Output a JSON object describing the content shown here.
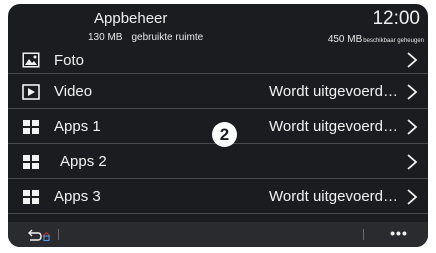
{
  "header": {
    "title": "Appbeheer",
    "time": "12:00",
    "used": {
      "value": "130 MB",
      "label": "gebruikte ruimte"
    },
    "available": {
      "value": "450 MB",
      "label": "beschikbaar geheugen"
    }
  },
  "rows": [
    {
      "label": "Foto",
      "status": "",
      "icon": "photo-icon"
    },
    {
      "label": "Video",
      "status": "Wordt uitgevoerd…",
      "icon": "play-icon"
    },
    {
      "label": "Apps 1",
      "status": "Wordt uitgevoerd…",
      "icon": "grid-icon"
    },
    {
      "label": "Apps 2",
      "status": "",
      "icon": "grid-icon"
    },
    {
      "label": "Apps 3",
      "status": "Wordt uitgevoerd…",
      "icon": "grid-icon"
    }
  ],
  "callout": "2",
  "bottom_bar": {
    "back_icon": "back-arrow-icon",
    "home_icon": "home-icon",
    "more_label": "•••"
  }
}
